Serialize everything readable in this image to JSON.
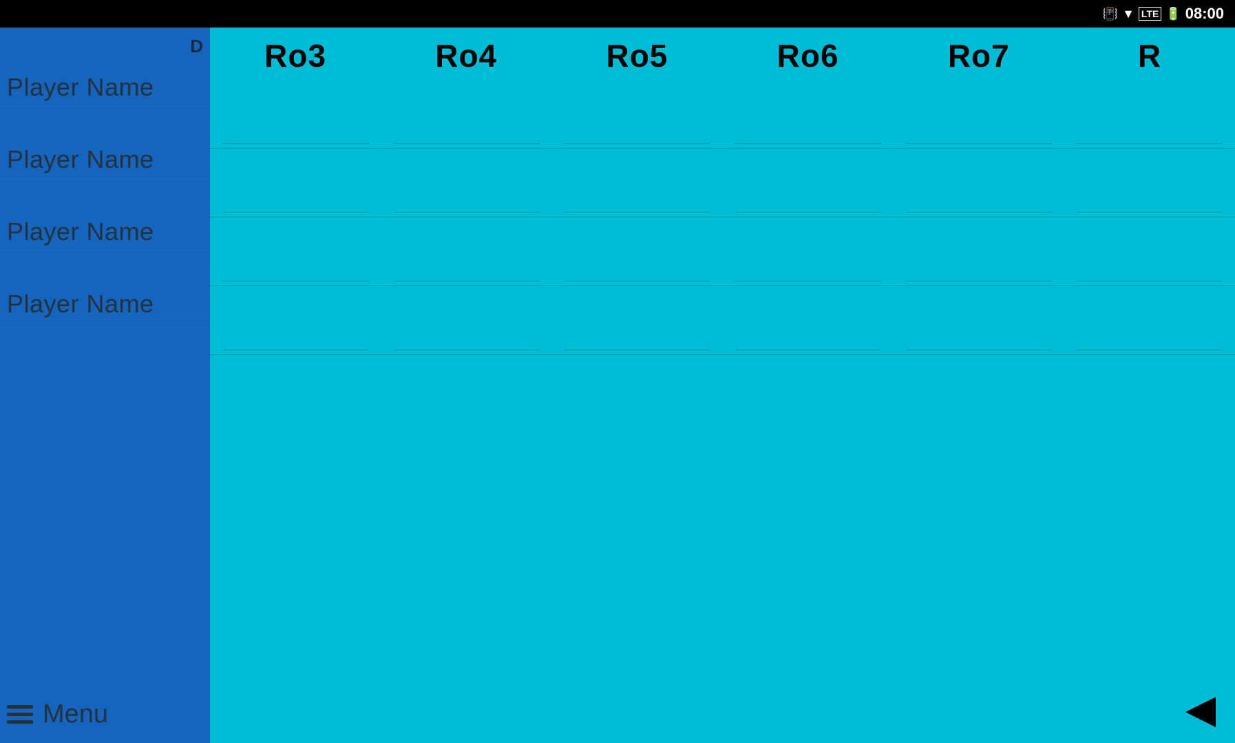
{
  "statusBar": {
    "time": "08:00",
    "icons": [
      "vibrate",
      "wifi",
      "lte",
      "battery"
    ]
  },
  "sidebar": {
    "players": [
      {
        "name": "Player Name",
        "showD": true
      },
      {
        "name": "Player Name",
        "showD": false
      },
      {
        "name": "Player Name",
        "showD": false
      },
      {
        "name": "Player Name",
        "showD": false
      }
    ],
    "menu": {
      "label": "Menu"
    }
  },
  "grid": {
    "columns": [
      {
        "label": "Ro3"
      },
      {
        "label": "Ro4"
      },
      {
        "label": "Ro5"
      },
      {
        "label": "Ro6"
      },
      {
        "label": "Ro7"
      },
      {
        "label": "R"
      }
    ],
    "rows": 4
  },
  "backButton": {
    "label": "back"
  }
}
